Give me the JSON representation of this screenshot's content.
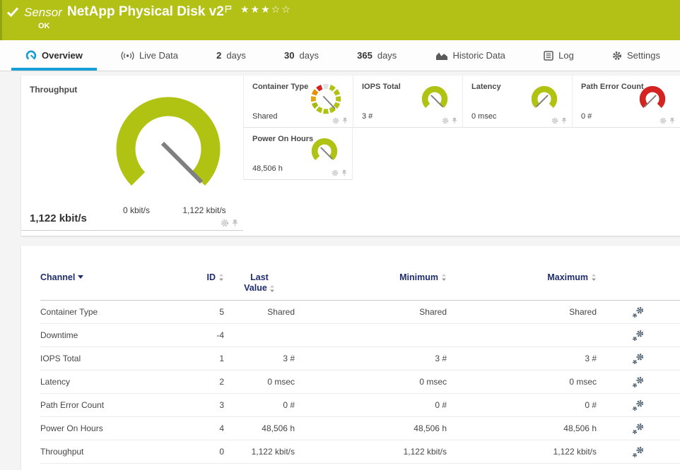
{
  "colors": {
    "green": "#b0c313",
    "red": "#d42321",
    "blue": "#189fd7",
    "needle": "#7f7f7f",
    "navy": "#1e2d6e",
    "topbar_green": "#b3c117"
  },
  "header": {
    "kind_label": "Sensor",
    "title": "NetApp Physical Disk v2",
    "status": "OK",
    "stars_filled": "★★★",
    "stars_empty": "☆☆"
  },
  "tabs": {
    "overview": "Overview",
    "live_data": "Live Data",
    "d2_num": "2",
    "d2_label": "days",
    "d30_num": "30",
    "d30_label": "days",
    "d365_num": "365",
    "d365_label": "days",
    "historic": "Historic Data",
    "log": "Log",
    "settings": "Settings"
  },
  "gauges": {
    "throughput": {
      "title": "Throughput",
      "value": "1,122 kbit/s",
      "scale_min": "0 kbit/s",
      "scale_max": "1,122 kbit/s"
    },
    "container_type": {
      "title": "Container Type",
      "value": "Shared",
      "segments": [
        "#e3e3e3",
        "#b0c313",
        "#b0c313",
        "#b0c313",
        "#b0c313",
        "#b0c313",
        "#b0c313",
        "#b0c313",
        "#a9b812",
        "#e2a50f",
        "#e88f00",
        "#d42321"
      ]
    },
    "iops_total": {
      "title": "IOPS Total",
      "value": "3 #",
      "color": "#b0c313"
    },
    "latency": {
      "title": "Latency",
      "value": "0 msec",
      "color": "#b0c313"
    },
    "path_error_count": {
      "title": "Path Error Count",
      "value": "0 #",
      "color": "#d42321"
    },
    "power_on_hours": {
      "title": "Power On Hours",
      "value": "48,506 h",
      "color": "#b0c313"
    }
  },
  "table": {
    "header": {
      "channel": "Channel",
      "id": "ID",
      "last1": "Last",
      "last2": "Value",
      "min": "Minimum",
      "max": "Maximum"
    },
    "rows": [
      [
        "Container Type",
        "5",
        "Shared",
        "Shared",
        "Shared"
      ],
      [
        "Downtime",
        "-4",
        "",
        "",
        ""
      ],
      [
        "IOPS Total",
        "1",
        "3 #",
        "3 #",
        "3 #"
      ],
      [
        "Latency",
        "2",
        "0 msec",
        "0 msec",
        "0 msec"
      ],
      [
        "Path Error Count",
        "3",
        "0 #",
        "0 #",
        "0 #"
      ],
      [
        "Power On Hours",
        "4",
        "48,506 h",
        "48,506 h",
        "48,506 h"
      ],
      [
        "Throughput",
        "0",
        "1,122 kbit/s",
        "1,122 kbit/s",
        "1,122 kbit/s"
      ]
    ]
  }
}
